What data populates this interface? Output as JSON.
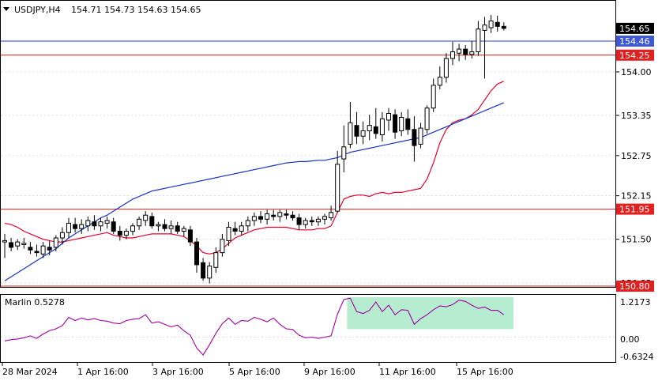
{
  "header": {
    "symbol": "USDJPY,H4",
    "ohlc": "154.71 154.73 154.63 154.65",
    "dropdown_icon": "triangle-down-icon"
  },
  "indicator": {
    "label": "Marlin 0.5278",
    "axis_ticks": [
      "1.2173",
      "0.00",
      "-0.6324"
    ]
  },
  "colors": {
    "background": "#ffffff",
    "grid": "#d4d4d4",
    "candle": "#000000",
    "ma_fast": "#e0002a",
    "ma_slow": "#1530c8",
    "level_blue": "#2a3cc8",
    "level_red": "#d01c1c",
    "tag_blue_bg": "#3f58d6",
    "tag_red_bg": "#e22020",
    "tag_black_bg": "#000000",
    "marlin_line": "#a000a0",
    "highlight": "#9ee6c0"
  },
  "chart_data": [
    {
      "type": "candlestick",
      "title": "USDJPY,H4",
      "ylim": [
        150.8,
        155.05
      ],
      "y_tick_labels": [
        "154.00",
        "153.35",
        "152.75",
        "152.15",
        "151.50",
        "150.85"
      ],
      "x_tick_labels": [
        "28 Mar 2024",
        "1 Apr 16:00",
        "3 Apr 16:00",
        "5 Apr 16:00",
        "9 Apr 16:00",
        "11 Apr 16:00",
        "15 Apr 16:00"
      ],
      "price_tags": [
        {
          "value": "154.65",
          "style": "black"
        },
        {
          "value": "154.46",
          "style": "blue"
        },
        {
          "value": "154.25",
          "style": "red"
        },
        {
          "value": "151.95",
          "style": "red"
        },
        {
          "value": "150.80",
          "style": "red"
        }
      ],
      "horizontal_levels": [
        {
          "value": 154.46,
          "color": "blue"
        },
        {
          "value": 154.25,
          "color": "red"
        },
        {
          "value": 151.95,
          "color": "red"
        },
        {
          "value": 150.8,
          "color": "red"
        }
      ],
      "candles": [
        [
          151.46,
          151.58,
          151.22,
          151.48
        ],
        [
          151.45,
          151.52,
          151.32,
          151.38
        ],
        [
          151.4,
          151.5,
          151.34,
          151.46
        ],
        [
          151.42,
          151.52,
          151.36,
          151.44
        ],
        [
          151.38,
          151.46,
          151.28,
          151.34
        ],
        [
          151.32,
          151.42,
          151.24,
          151.3
        ],
        [
          151.28,
          151.46,
          151.22,
          151.4
        ],
        [
          151.38,
          151.48,
          151.26,
          151.34
        ],
        [
          151.38,
          151.56,
          151.32,
          151.52
        ],
        [
          151.52,
          151.68,
          151.42,
          151.6
        ],
        [
          151.6,
          151.82,
          151.52,
          151.74
        ],
        [
          151.72,
          151.82,
          151.6,
          151.66
        ],
        [
          151.66,
          151.8,
          151.58,
          151.72
        ],
        [
          151.7,
          151.84,
          151.62,
          151.78
        ],
        [
          151.76,
          151.86,
          151.64,
          151.7
        ],
        [
          151.7,
          151.82,
          151.62,
          151.76
        ],
        [
          151.74,
          151.84,
          151.66,
          151.78
        ],
        [
          151.76,
          151.82,
          151.58,
          151.62
        ],
        [
          151.62,
          151.7,
          151.48,
          151.56
        ],
        [
          151.56,
          151.66,
          151.5,
          151.62
        ],
        [
          151.62,
          151.74,
          151.56,
          151.7
        ],
        [
          151.7,
          151.84,
          151.64,
          151.8
        ],
        [
          151.78,
          151.92,
          151.7,
          151.86
        ],
        [
          151.84,
          151.9,
          151.66,
          151.7
        ],
        [
          151.7,
          151.76,
          151.62,
          151.72
        ],
        [
          151.72,
          151.8,
          151.62,
          151.66
        ],
        [
          151.66,
          151.78,
          151.58,
          151.7
        ],
        [
          151.7,
          151.76,
          151.58,
          151.62
        ],
        [
          151.62,
          151.7,
          151.54,
          151.66
        ],
        [
          151.64,
          151.7,
          151.4,
          151.46
        ],
        [
          151.46,
          151.52,
          151.0,
          151.12
        ],
        [
          151.15,
          151.22,
          150.88,
          150.92
        ],
        [
          150.92,
          151.16,
          150.84,
          151.1
        ],
        [
          151.08,
          151.38,
          151.0,
          151.3
        ],
        [
          151.3,
          151.58,
          151.24,
          151.5
        ],
        [
          151.48,
          151.76,
          151.4,
          151.68
        ],
        [
          151.66,
          151.76,
          151.56,
          151.62
        ],
        [
          151.62,
          151.76,
          151.56,
          151.7
        ],
        [
          151.7,
          151.84,
          151.62,
          151.78
        ],
        [
          151.78,
          151.9,
          151.7,
          151.84
        ],
        [
          151.84,
          151.92,
          151.74,
          151.8
        ],
        [
          151.8,
          151.94,
          151.72,
          151.88
        ],
        [
          151.86,
          151.94,
          151.78,
          151.84
        ],
        [
          151.84,
          151.94,
          151.76,
          151.9
        ],
        [
          151.88,
          151.94,
          151.8,
          151.86
        ],
        [
          151.86,
          151.92,
          151.78,
          151.82
        ],
        [
          151.82,
          151.88,
          151.64,
          151.72
        ],
        [
          151.72,
          151.82,
          151.66,
          151.78
        ],
        [
          151.78,
          151.84,
          151.7,
          151.76
        ],
        [
          151.76,
          151.84,
          151.7,
          151.8
        ],
        [
          151.8,
          151.88,
          151.72,
          151.84
        ],
        [
          151.82,
          152.0,
          151.78,
          151.9
        ],
        [
          151.92,
          152.82,
          151.9,
          152.62
        ],
        [
          152.7,
          153.2,
          152.5,
          152.88
        ],
        [
          152.92,
          153.55,
          152.86,
          153.24
        ],
        [
          153.2,
          153.4,
          152.92,
          153.04
        ],
        [
          153.04,
          153.26,
          152.92,
          153.12
        ],
        [
          153.12,
          153.36,
          152.98,
          153.2
        ],
        [
          153.18,
          153.46,
          153.0,
          153.08
        ],
        [
          153.06,
          153.4,
          152.96,
          153.3
        ],
        [
          153.28,
          153.46,
          153.12,
          153.38
        ],
        [
          153.36,
          153.44,
          153.0,
          153.1
        ],
        [
          153.12,
          153.4,
          153.04,
          153.32
        ],
        [
          153.3,
          153.44,
          153.06,
          153.14
        ],
        [
          153.14,
          153.34,
          152.66,
          152.9
        ],
        [
          152.92,
          153.24,
          152.86,
          153.16
        ],
        [
          153.14,
          153.5,
          153.08,
          153.46
        ],
        [
          153.46,
          153.9,
          153.4,
          153.8
        ],
        [
          153.8,
          154.08,
          153.74,
          153.92
        ],
        [
          153.92,
          154.28,
          153.84,
          154.2
        ],
        [
          154.2,
          154.45,
          154.1,
          154.3
        ],
        [
          154.28,
          154.42,
          154.16,
          154.34
        ],
        [
          154.34,
          154.4,
          154.18,
          154.26
        ],
        [
          154.26,
          154.46,
          154.2,
          154.3
        ],
        [
          154.3,
          154.76,
          154.24,
          154.64
        ],
        [
          154.62,
          154.82,
          153.9,
          154.7
        ],
        [
          154.66,
          154.85,
          154.58,
          154.76
        ],
        [
          154.74,
          154.84,
          154.6,
          154.68
        ],
        [
          154.68,
          154.74,
          154.62,
          154.65
        ]
      ],
      "series": [
        {
          "name": "",
          "color": "red",
          "values": [
            151.74,
            151.72,
            151.68,
            151.62,
            151.58,
            151.54,
            151.5,
            151.48,
            151.46,
            151.46,
            151.48,
            151.5,
            151.52,
            151.54,
            151.56,
            151.58,
            151.6,
            151.56,
            151.54,
            151.52,
            151.52,
            151.54,
            151.56,
            151.58,
            151.58,
            151.58,
            151.58,
            151.56,
            151.54,
            151.48,
            151.4,
            151.3,
            151.28,
            151.3,
            151.36,
            151.44,
            151.52,
            151.56,
            151.6,
            151.64,
            151.66,
            151.68,
            151.68,
            151.68,
            151.68,
            151.66,
            151.64,
            151.64,
            151.64,
            151.66,
            151.66,
            151.7,
            151.9,
            152.1,
            152.14,
            152.16,
            152.16,
            152.14,
            152.18,
            152.2,
            152.18,
            152.2,
            152.2,
            152.22,
            152.24,
            152.26,
            152.4,
            152.64,
            152.94,
            153.14,
            153.24,
            153.28,
            153.3,
            153.36,
            153.44,
            153.58,
            153.72,
            153.82,
            153.86
          ]
        },
        {
          "name": "",
          "color": "blue",
          "values": [
            150.88,
            150.94,
            151.0,
            151.06,
            151.12,
            151.18,
            151.24,
            151.3,
            151.36,
            151.44,
            151.52,
            151.58,
            151.64,
            151.7,
            151.76,
            151.82,
            151.86,
            151.92,
            151.98,
            152.04,
            152.1,
            152.14,
            152.18,
            152.22,
            152.24,
            152.26,
            152.28,
            152.3,
            152.32,
            152.34,
            152.36,
            152.38,
            152.4,
            152.42,
            152.44,
            152.46,
            152.48,
            152.5,
            152.52,
            152.54,
            152.56,
            152.58,
            152.6,
            152.62,
            152.64,
            152.65,
            152.66,
            152.66,
            152.67,
            152.68,
            152.68,
            152.7,
            152.72,
            152.76,
            152.8,
            152.82,
            152.84,
            152.86,
            152.88,
            152.9,
            152.92,
            152.94,
            152.96,
            152.98,
            153.0,
            153.02,
            153.06,
            153.1,
            153.14,
            153.18,
            153.22,
            153.26,
            153.3,
            153.34,
            153.38,
            153.42,
            153.46,
            153.5,
            153.54
          ]
        }
      ]
    },
    {
      "type": "line",
      "title": "Marlin 0.5278",
      "ylim": [
        -0.78,
        1.3
      ],
      "highlight_range": {
        "x": [
          54,
          79
        ],
        "y": [
          0.25,
          1.25
        ]
      },
      "series": [
        {
          "name": "",
          "color": "magenta",
          "values": [
            -0.12,
            -0.08,
            -0.06,
            -0.02,
            0.04,
            -0.04,
            0.1,
            0.2,
            0.26,
            0.36,
            0.62,
            0.52,
            0.6,
            0.54,
            0.58,
            0.52,
            0.5,
            0.44,
            0.42,
            0.52,
            0.56,
            0.58,
            0.7,
            0.44,
            0.48,
            0.4,
            0.32,
            0.38,
            0.2,
            0.06,
            -0.34,
            -0.56,
            -0.24,
            0.12,
            0.42,
            0.6,
            0.4,
            0.52,
            0.5,
            0.62,
            0.56,
            0.48,
            0.6,
            0.4,
            0.26,
            0.24,
            0.06,
            -0.02,
            0.0,
            -0.04,
            0.0,
            0.04,
            0.72,
            1.18,
            1.22,
            0.8,
            0.74,
            0.84,
            1.1,
            0.8,
            1.0,
            0.7,
            0.86,
            0.84,
            0.4,
            0.58,
            0.7,
            0.86,
            0.98,
            0.95,
            1.02,
            1.16,
            1.12,
            1.0,
            0.9,
            0.94,
            0.84,
            0.84,
            0.7
          ]
        }
      ]
    }
  ]
}
